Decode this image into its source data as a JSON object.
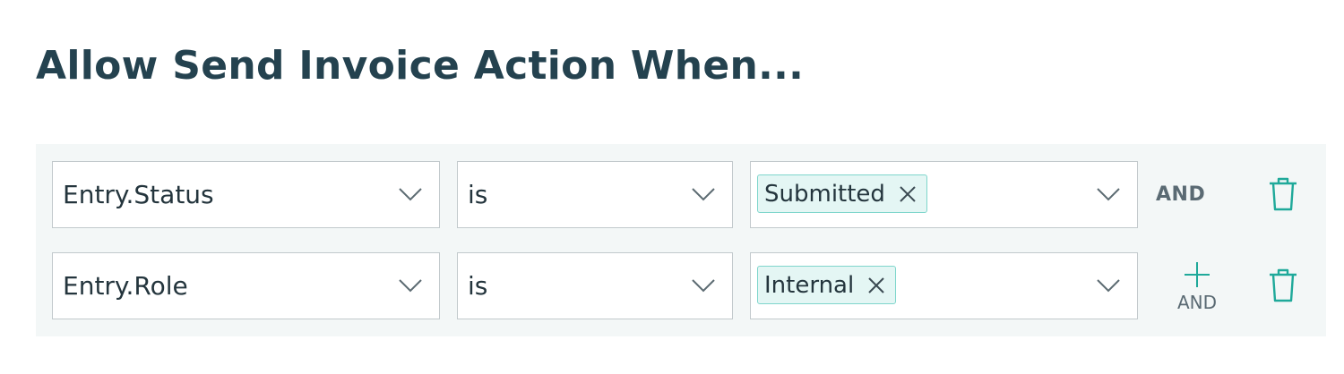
{
  "title": "Allow Send Invoice Action When...",
  "colors": {
    "title": "#24424f",
    "accent": "#1fa99a",
    "chip_bg": "#e4f6f4",
    "chip_border": "#7fd6cc",
    "panel_bg": "#f3f7f7"
  },
  "conditions": [
    {
      "field": "Entry.Status",
      "operator": "is",
      "value_chips": [
        "Submitted"
      ],
      "connector": "AND"
    },
    {
      "field": "Entry.Role",
      "operator": "is",
      "value_chips": [
        "Internal"
      ],
      "add_connector_label": "AND"
    }
  ],
  "icons": {
    "dropdown": "chevron-down-icon",
    "remove_chip": "close-icon",
    "delete_row": "trash-icon",
    "add": "plus-icon"
  }
}
